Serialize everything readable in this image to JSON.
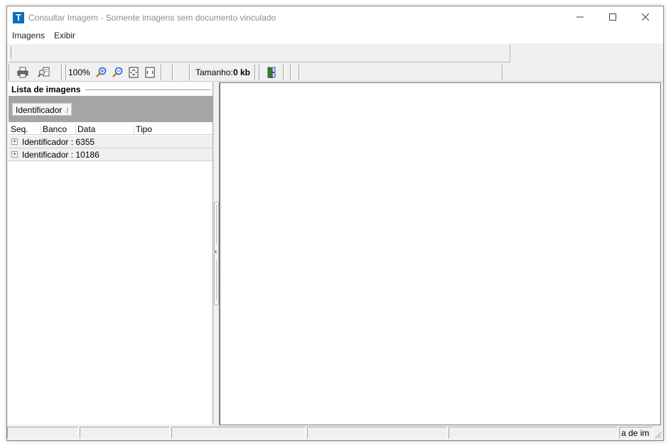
{
  "window": {
    "title": "Consultar Imagem - Somente imagens sem documento vinculado",
    "app_icon_letter": "T"
  },
  "menu": {
    "items": [
      "Imagens",
      "Exibir"
    ]
  },
  "toolbar": {
    "zoom": "100%",
    "size_label": "Tamanho:",
    "size_value": "0 kb"
  },
  "image_list": {
    "title": "Lista de imagens",
    "group_by": "Identificador",
    "columns": [
      "Seq.",
      "Banco",
      "Data",
      "Tipo"
    ],
    "rows": [
      "Identificador : 6355",
      "Identificador : 10186"
    ],
    "expander_symbol": "+"
  },
  "status": {
    "cell6": "a de im"
  },
  "colors": {
    "app_icon": "#0a6fb8",
    "group_area": "#a5a5a5"
  }
}
